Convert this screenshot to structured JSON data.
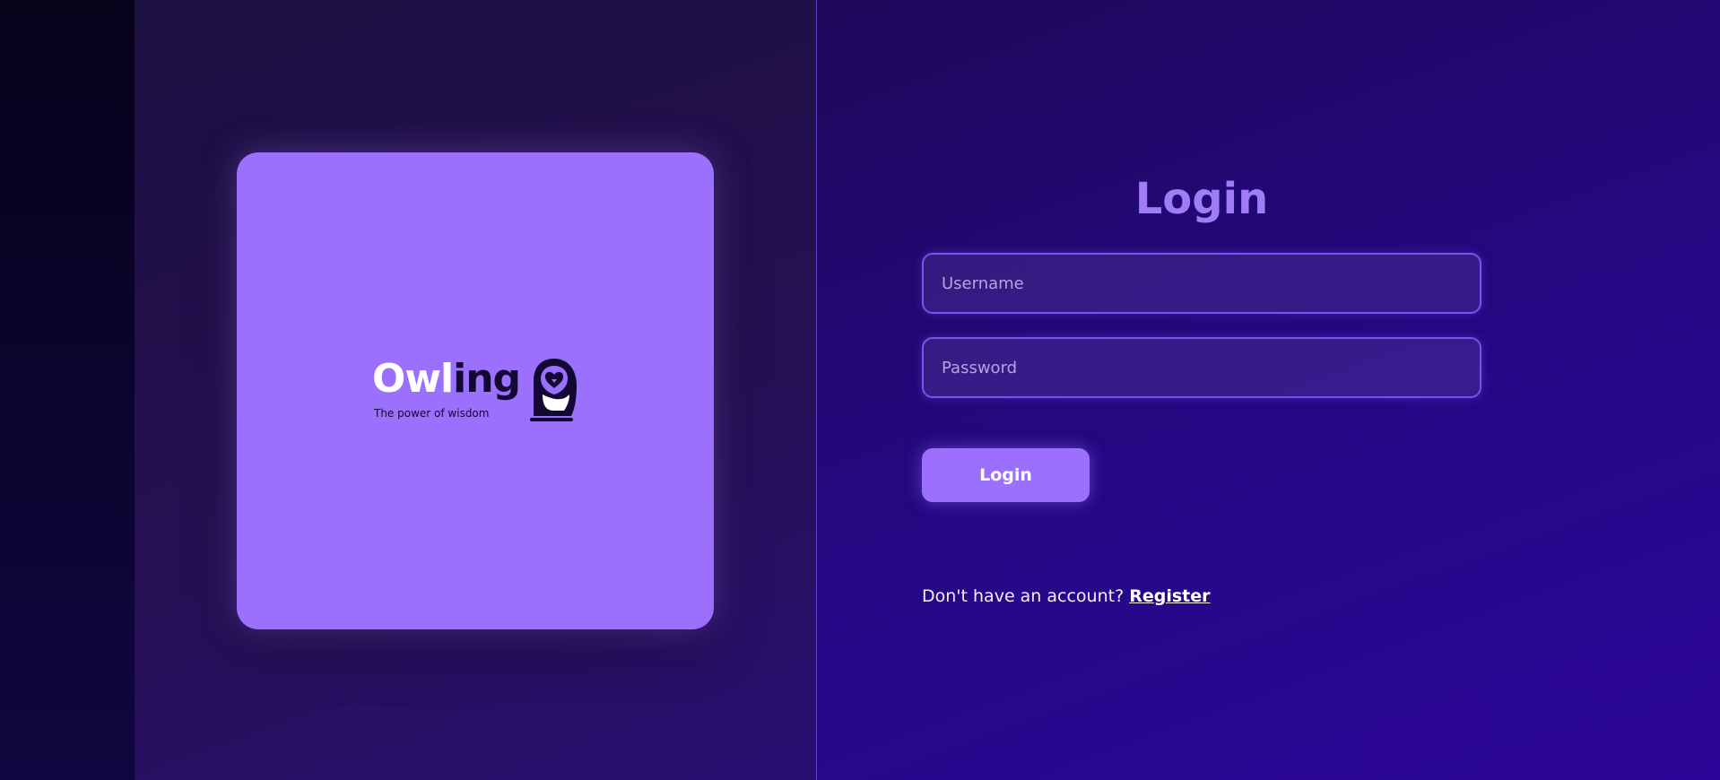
{
  "logo": {
    "word_light": "Owl",
    "word_dark": "ing",
    "tagline": "The power of wisdom"
  },
  "login": {
    "title": "Login",
    "username_placeholder": "Username",
    "username_value": "",
    "password_placeholder": "Password",
    "password_value": "",
    "button_label": "Login",
    "register_prompt": "Don't have an account?",
    "register_link": "Register"
  },
  "colors": {
    "accent": "#9a70fc",
    "title": "#a07cf7",
    "field_border": "#7a52f0",
    "background_dark": "#150c3a",
    "background_deep": "#2a0797"
  },
  "icons": {
    "owl_mark": "owl-icon"
  }
}
